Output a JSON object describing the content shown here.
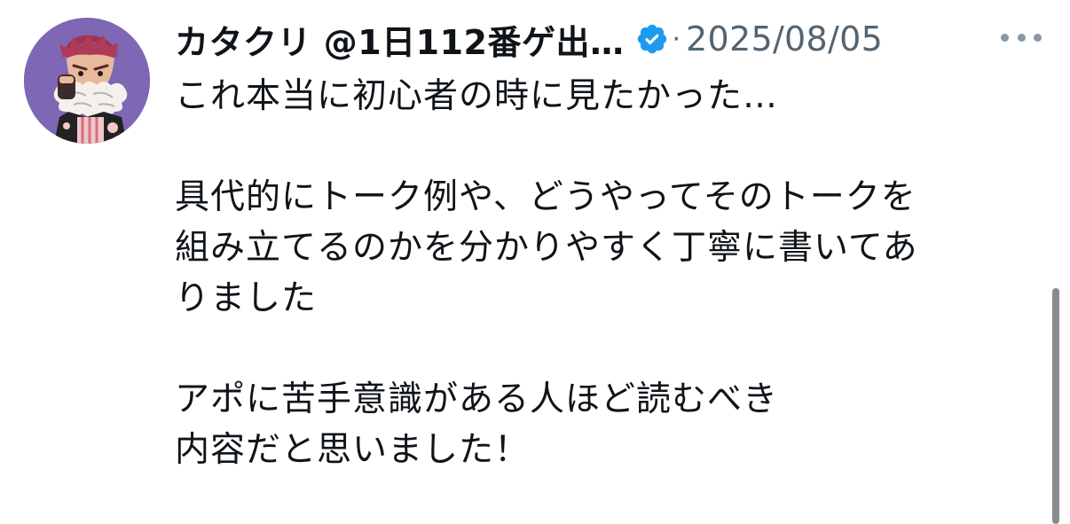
{
  "post": {
    "display_name": "カタクリ @1日112番ゲ出…",
    "separator": "·",
    "date": "2025/08/05",
    "text_lines": [
      "これ本当に初心者の時に見たかった…",
      "",
      "具代的にトーク例や、どうやってそのトークを",
      "組み立てるのかを分かりやすく丁寧に書いてあ",
      "りました",
      "",
      "アポに苦手意識がある人ほど読むべき",
      "内容だと思いました！"
    ]
  },
  "icons": {
    "verified": "verified-badge-icon",
    "more": "more-options-icon",
    "avatar": "avatar-image"
  },
  "colors": {
    "verified_blue": "#1d9bf0",
    "secondary_text": "#536471",
    "primary_text": "#0f1419",
    "avatar_bg": "#7e67b5"
  }
}
